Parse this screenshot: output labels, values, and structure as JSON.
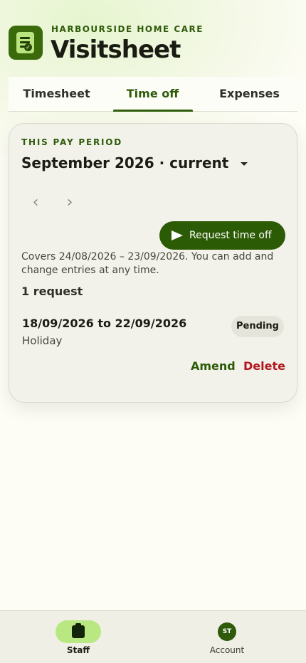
{
  "header": {
    "brand": "HARBOURSIDE HOME CARE",
    "title": "Visitsheet",
    "icon": "clipboard-check-icon"
  },
  "tabs": [
    {
      "label": "Timesheet",
      "active": false
    },
    {
      "label": "Time off",
      "active": true
    },
    {
      "label": "Expenses",
      "active": false
    }
  ],
  "period": {
    "label": "THIS PAY PERIOD",
    "selected": "September 2026 · current",
    "prev_icon": "chevron-left-icon",
    "next_icon": "chevron-right-icon",
    "covers_text": "Covers 24/08/2026 – 23/09/2026. You can add and change entries at any time.",
    "request_button": "Request time off",
    "request_count": "1 request"
  },
  "requests": [
    {
      "dates": "18/09/2026 to 22/09/2026",
      "type": "Holiday",
      "status": "Pending",
      "amend_label": "Amend",
      "delete_label": "Delete"
    }
  ],
  "bottom_nav": {
    "staff_label": "Staff",
    "account_label": "Account",
    "avatar_initials": "ST"
  },
  "colors": {
    "accent": "#2d5b08",
    "accent_light": "#b9e882",
    "danger": "#b3161d"
  }
}
